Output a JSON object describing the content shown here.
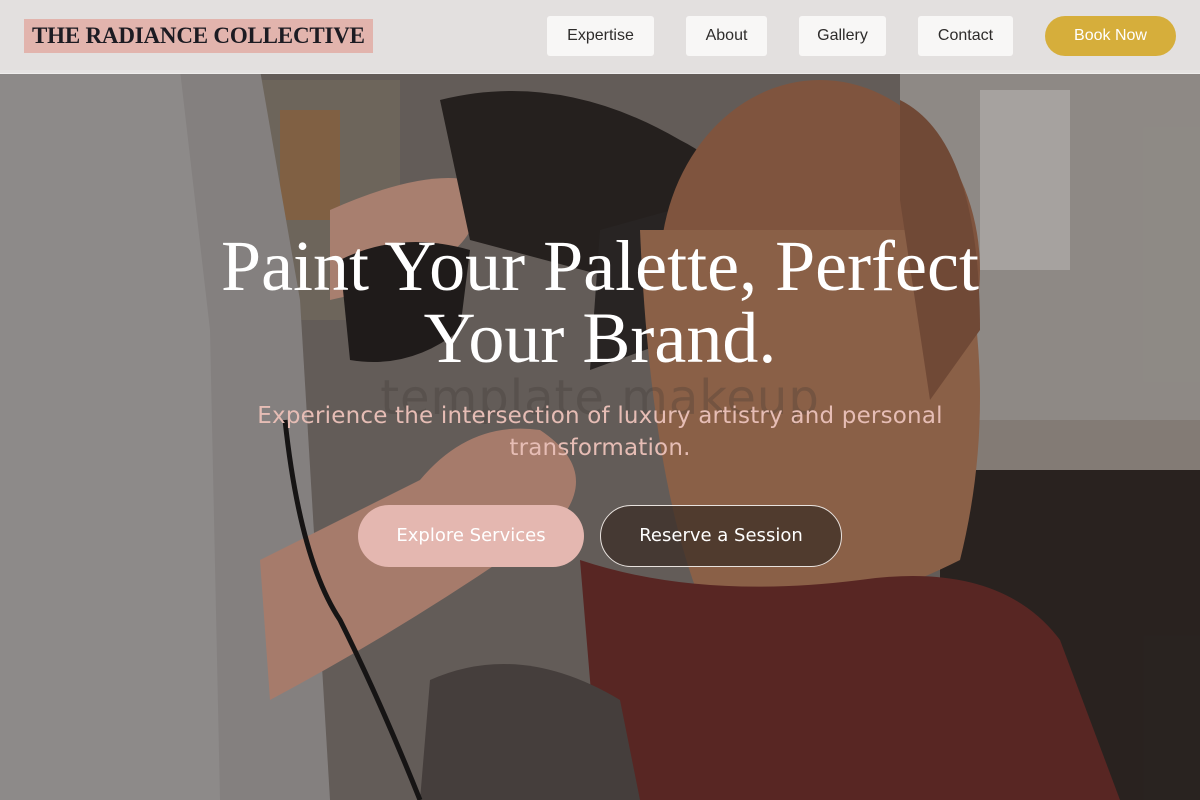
{
  "nav": {
    "brand": "THE RADIANCE COLLECTIVE",
    "links": [
      "Expertise",
      "About",
      "Gallery",
      "Contact"
    ],
    "cta": "Book Now"
  },
  "hero": {
    "title": "Paint Your Palette, Perfect Your Brand.",
    "watermark": "template makeup",
    "subtitle": "Experience the intersection of luxury artistry and personal transformation.",
    "primary_button": "Explore Services",
    "secondary_button": "Reserve a Session"
  },
  "colors": {
    "brand_bg": "#e2b4ad",
    "cta_gold": "#d6ae3b",
    "primary_pink": "#e4b7b0",
    "subtitle_pink": "#e6bdb5"
  }
}
